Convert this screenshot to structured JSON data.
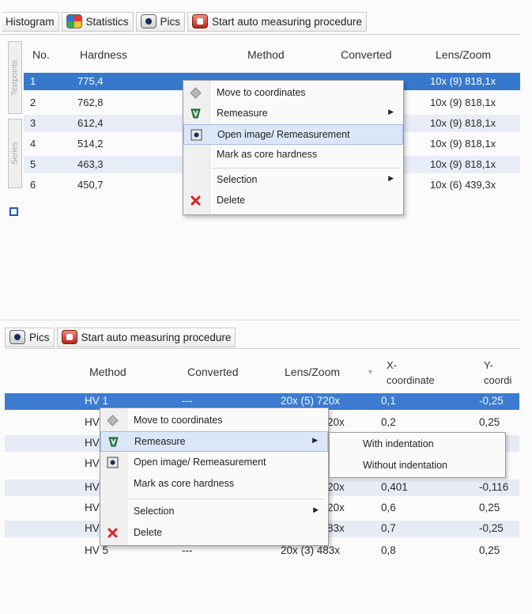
{
  "top_tabs": [
    "Histogram",
    "Statistics",
    "Pics",
    "Start auto measuring procedure"
  ],
  "side_tabs": [
    "Testpoints",
    "Series"
  ],
  "table1": {
    "columns": [
      "No.",
      "Hardness",
      "Method",
      "Converted",
      "Lens/Zoom"
    ],
    "rows": [
      {
        "no": "1",
        "hardness": "775,4",
        "lens": "10x (9) 818,1x"
      },
      {
        "no": "2",
        "hardness": "762,8",
        "lens": "10x (9) 818,1x"
      },
      {
        "no": "3",
        "hardness": "612,4",
        "lens": "10x (9) 818,1x"
      },
      {
        "no": "4",
        "hardness": "514,2",
        "lens": "10x (9) 818,1x"
      },
      {
        "no": "5",
        "hardness": "463,3",
        "lens": "10x (9) 818,1x"
      },
      {
        "no": "6",
        "hardness": "450,7",
        "lens": "10x (6) 439,3x"
      }
    ]
  },
  "menu1": {
    "items": [
      "Move to coordinates",
      "Remeasure",
      "Open image/ Remeasurement",
      "Mark as core hardness",
      "Selection",
      "Delete"
    ]
  },
  "bottom_tabs": [
    "Pics",
    "Start auto measuring procedure"
  ],
  "table2": {
    "columns": [
      "Method",
      "Converted",
      "Lens/Zoom",
      "X-",
      "coordinate",
      "Y-",
      "coordi"
    ],
    "rows": [
      {
        "method": "HV 1",
        "converted": "---",
        "lens": "20x (5) 720x",
        "x": "0,1",
        "y": "-0,25"
      },
      {
        "method": "HV",
        "converted": "",
        "lens": "20x",
        "x": "0,2",
        "y": "0,25"
      },
      {
        "method": "HV",
        "converted": "",
        "lens": "",
        "x": "",
        "y": ""
      },
      {
        "method": "HV",
        "converted": "",
        "lens": "",
        "x": "",
        "y": ""
      },
      {
        "method": "HV",
        "converted": "",
        "lens": "20x",
        "x": "0,401",
        "y": "-0,116"
      },
      {
        "method": "HV",
        "converted": "",
        "lens": "20x",
        "x": "0,6",
        "y": "0,25"
      },
      {
        "method": "HV",
        "converted": "",
        "lens": "83x",
        "x": "0,7",
        "y": "-0,25"
      },
      {
        "method": "HV 5",
        "converted": "---",
        "lens": "20x (3) 483x",
        "x": "0,8",
        "y": "0,25"
      }
    ]
  },
  "menu2": {
    "items": [
      "Move to coordinates",
      "Remeasure",
      "Open image/ Remeasurement",
      "Mark as core hardness",
      "Selection",
      "Delete"
    ]
  },
  "submenu": {
    "items": [
      "With indentation",
      "Without indentation"
    ]
  }
}
